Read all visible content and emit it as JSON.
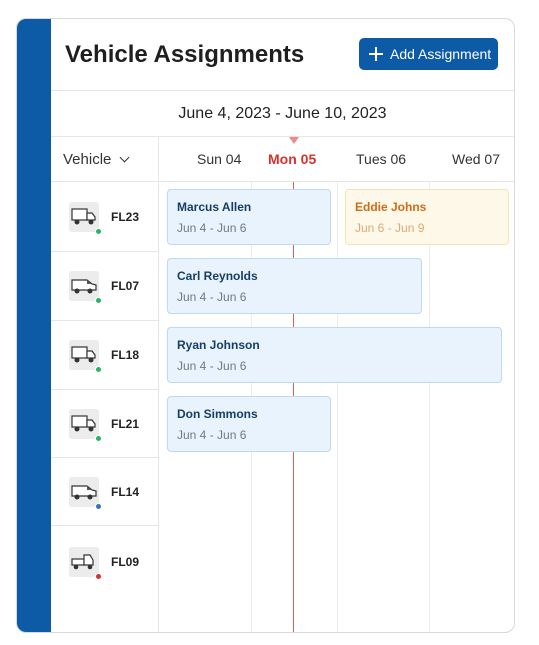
{
  "header": {
    "title": "Vehicle Assignments",
    "add_button_label": "Add Assignment"
  },
  "date_range": "June 4, 2023 - June 10, 2023",
  "filter": {
    "label": "Vehicle"
  },
  "days": [
    {
      "label": "Sun 04",
      "today": false
    },
    {
      "label": "Mon 05",
      "today": true
    },
    {
      "label": "Tues 06",
      "today": false
    },
    {
      "label": "Wed 07",
      "today": false
    }
  ],
  "colors": {
    "accent": "#0d5aa7",
    "today": "#d9302e",
    "available": "#28b463",
    "in_use": "#2f74d0",
    "maintenance": "#d9302e"
  },
  "vehicles": [
    {
      "code": "FL23",
      "icon": "box-truck-icon",
      "status": "available"
    },
    {
      "code": "FL07",
      "icon": "van-icon",
      "status": "available"
    },
    {
      "code": "FL18",
      "icon": "box-truck-icon",
      "status": "available"
    },
    {
      "code": "FL21",
      "icon": "box-truck-icon",
      "status": "available"
    },
    {
      "code": "FL14",
      "icon": "van-icon",
      "status": "in_use"
    },
    {
      "code": "FL09",
      "icon": "semi-truck-icon",
      "status": "maintenance"
    }
  ],
  "assignments": [
    {
      "vehicle": "FL23",
      "driver": "Marcus Allen",
      "dates": "Jun 4 - Jun 6",
      "style": "blue"
    },
    {
      "vehicle": "FL23",
      "driver": "Eddie Johns",
      "dates": "Jun 6 - Jun 9",
      "style": "orange"
    },
    {
      "vehicle": "FL07",
      "driver": "Carl Reynolds",
      "dates": "Jun 4 - Jun 6",
      "style": "blue"
    },
    {
      "vehicle": "FL18",
      "driver": "Ryan Johnson",
      "dates": "Jun 4 - Jun 6",
      "style": "blue"
    },
    {
      "vehicle": "FL21",
      "driver": "Don Simmons",
      "dates": "Jun 4 - Jun 6",
      "style": "blue"
    }
  ]
}
